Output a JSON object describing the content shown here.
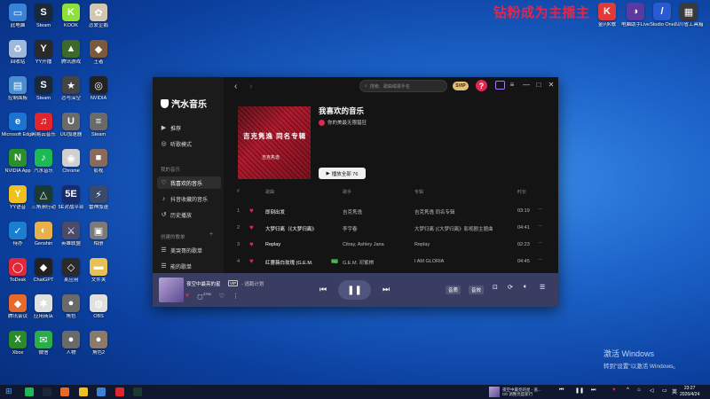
{
  "desktop": {
    "watermark": "钻粉成为主播主",
    "activate_line1": "激活 Windows",
    "activate_line2": "转到\"设置\"以激活 Windows。",
    "icons_left": [
      {
        "label": "此电脑",
        "color": "#3a82d6",
        "glyph": "▭"
      },
      {
        "label": "Steam",
        "color": "#1b2838",
        "glyph": "S"
      },
      {
        "label": "KOOK",
        "color": "#8ee03a",
        "glyph": "K"
      },
      {
        "label": "恋爱企鹅",
        "color": "#d3c7b0",
        "glyph": "✿"
      },
      {
        "label": "回收站",
        "color": "#9fb7d8",
        "glyph": "♻"
      },
      {
        "label": "YY开播",
        "color": "#2a2a2a",
        "glyph": "Y"
      },
      {
        "label": "腾讯游戏",
        "color": "#3d6a2b",
        "glyph": "▲"
      },
      {
        "label": "王者",
        "color": "#7a5a3a",
        "glyph": "◆"
      },
      {
        "label": "控制面板",
        "color": "#4a8ed0",
        "glyph": "▤"
      },
      {
        "label": "Steam",
        "color": "#1b2838",
        "glyph": "S"
      },
      {
        "label": "恋与深空",
        "color": "#444",
        "glyph": "★"
      },
      {
        "label": "NVIDIA",
        "color": "#222",
        "glyph": "◎"
      },
      {
        "label": "Microsoft Edge",
        "color": "#1b74d1",
        "glyph": "e"
      },
      {
        "label": "网易云音乐",
        "color": "#e0262c",
        "glyph": "♫"
      },
      {
        "label": "UU加速器",
        "color": "#6a6a6a",
        "glyph": "U"
      },
      {
        "label": "Steam",
        "color": "#6a6a6a",
        "glyph": "≡"
      },
      {
        "label": "NVIDIA App",
        "color": "#2b8f2b",
        "glyph": "N"
      },
      {
        "label": "汽水音乐",
        "color": "#1db954",
        "glyph": "♪"
      },
      {
        "label": "Chrome",
        "color": "#d0d0d0",
        "glyph": "◉"
      },
      {
        "label": "影视",
        "color": "#8a6a5a",
        "glyph": "■"
      },
      {
        "label": "YY语音",
        "color": "#f0c020",
        "glyph": "Y"
      },
      {
        "label": "三角洲行动",
        "color": "#1b3a30",
        "glyph": "△"
      },
      {
        "label": "5E对战平台",
        "color": "#1a2a6a",
        "glyph": "5E"
      },
      {
        "label": "雷神加速",
        "color": "#3a4a6a",
        "glyph": "⚡"
      },
      {
        "label": "待办",
        "color": "#1b7fd1",
        "glyph": "✓"
      },
      {
        "label": "Genshin",
        "color": "#e8b04a",
        "glyph": "◐"
      },
      {
        "label": "英雄联盟",
        "color": "#4a4a6a",
        "glyph": "⚔"
      },
      {
        "label": "相册",
        "color": "#7a7a7a",
        "glyph": "▣"
      },
      {
        "label": "ToDesk",
        "color": "#e0283a",
        "glyph": "◯"
      },
      {
        "label": "ChatGPT",
        "color": "#222",
        "glyph": "◆"
      },
      {
        "label": "某应用",
        "color": "#2a2a2a",
        "glyph": "◇"
      },
      {
        "label": "文件夹",
        "color": "#e6c15a",
        "glyph": "▬"
      },
      {
        "label": "腾讯会议",
        "color": "#e86a2a",
        "glyph": "◆"
      },
      {
        "label": "应用商店",
        "color": "#e0e0e0",
        "glyph": "✱"
      },
      {
        "label": "角色",
        "color": "#6a6a6a",
        "glyph": "●"
      },
      {
        "label": "OBS",
        "color": "#e0e0e0",
        "glyph": "◍"
      },
      {
        "label": "Xbox",
        "color": "#2a8a2a",
        "glyph": "X"
      },
      {
        "label": "微信",
        "color": "#2aae4a",
        "glyph": "✉"
      },
      {
        "label": "人物",
        "color": "#6a6a6a",
        "glyph": "●"
      },
      {
        "label": "角色2",
        "color": "#8a7a6a",
        "glyph": "●"
      }
    ],
    "icons_top_right": [
      {
        "label": "金闪K歌",
        "color": "#e03a3a",
        "glyph": "K"
      },
      {
        "label": "电脑助手Live",
        "color": "#5a3aa0",
        "glyph": "◑"
      },
      {
        "label": "Studio One",
        "color": "#2a5ad0",
        "glyph": "/"
      },
      {
        "label": "四川省工具箱",
        "color": "#3a3a3a",
        "glyph": "▦"
      }
    ]
  },
  "app": {
    "logo": "汽水音乐",
    "nav": [
      {
        "icon": "▶",
        "label": "推荐",
        "icon_name": "play-icon"
      },
      {
        "icon": "◎",
        "label": "听歌模式",
        "icon_name": "listen-icon"
      }
    ],
    "my_music_label": "我的音乐",
    "my_music": [
      {
        "icon": "♡",
        "label": "我喜欢的音乐",
        "icon_name": "heart-icon",
        "active": true
      },
      {
        "icon": "♪",
        "label": "抖音收藏的音乐",
        "icon_name": "douyin-icon"
      },
      {
        "icon": "↺",
        "label": "历史播放",
        "icon_name": "history-icon"
      }
    ],
    "created_label": "创建的歌单",
    "created_plus": "+",
    "created": [
      {
        "icon": "☰",
        "label": "美哭哥的歌单",
        "icon_name": "playlist-icon"
      },
      {
        "icon": "☰",
        "label": "能的歌单",
        "icon_name": "playlist-icon"
      }
    ],
    "search_placeholder": "搜索、歌曲或歌手名",
    "svip": "SVIP",
    "help": "?",
    "playlist": {
      "cover_title": "吉克隽逸 同名专辑",
      "cover_sub": "吉克隽逸",
      "title": "我喜欢的音乐",
      "user": "你的美最无限猖狂",
      "play_all": "播放全部 76"
    },
    "table_headers": {
      "num": "#",
      "title": "歌曲",
      "artist": "歌手",
      "album": "专辑",
      "dur": "时长"
    },
    "rows": [
      {
        "num": "1",
        "title": "即刻出发",
        "artist": "吉克隽逸",
        "album": "吉克隽逸 同名专辑",
        "dur": "03:19"
      },
      {
        "num": "2",
        "title": "大梦归离（《大梦归离》",
        "artist": "李宇春",
        "album": "大梦归离 (《大梦归离》影视剧主题曲)",
        "dur": "04:41"
      },
      {
        "num": "3",
        "title": "Replay",
        "artist": "Citray, Ashley Jana",
        "album": "Replay",
        "dur": "02:23"
      },
      {
        "num": "4",
        "title": "红蔷薇白玫瑰 (G.E.M.",
        "artist": "G.E.M. 邓紫棋",
        "album": "I AM GLORIA",
        "dur": "04:45",
        "tag": "SQ"
      }
    ],
    "more": "···",
    "player": {
      "title": "夜空中最亮的星",
      "vip": "VIP",
      "sub": "- 逃跑计划",
      "comment_count": "3796",
      "btn_a": "音质",
      "btn_b": "音效"
    }
  },
  "taskbar": {
    "now_title": "夜空中最亮的星 - 逃...",
    "now_sub": "Oh 调整亮度新行",
    "time": "23:27",
    "date": "2026/4/24",
    "lang": "英"
  }
}
